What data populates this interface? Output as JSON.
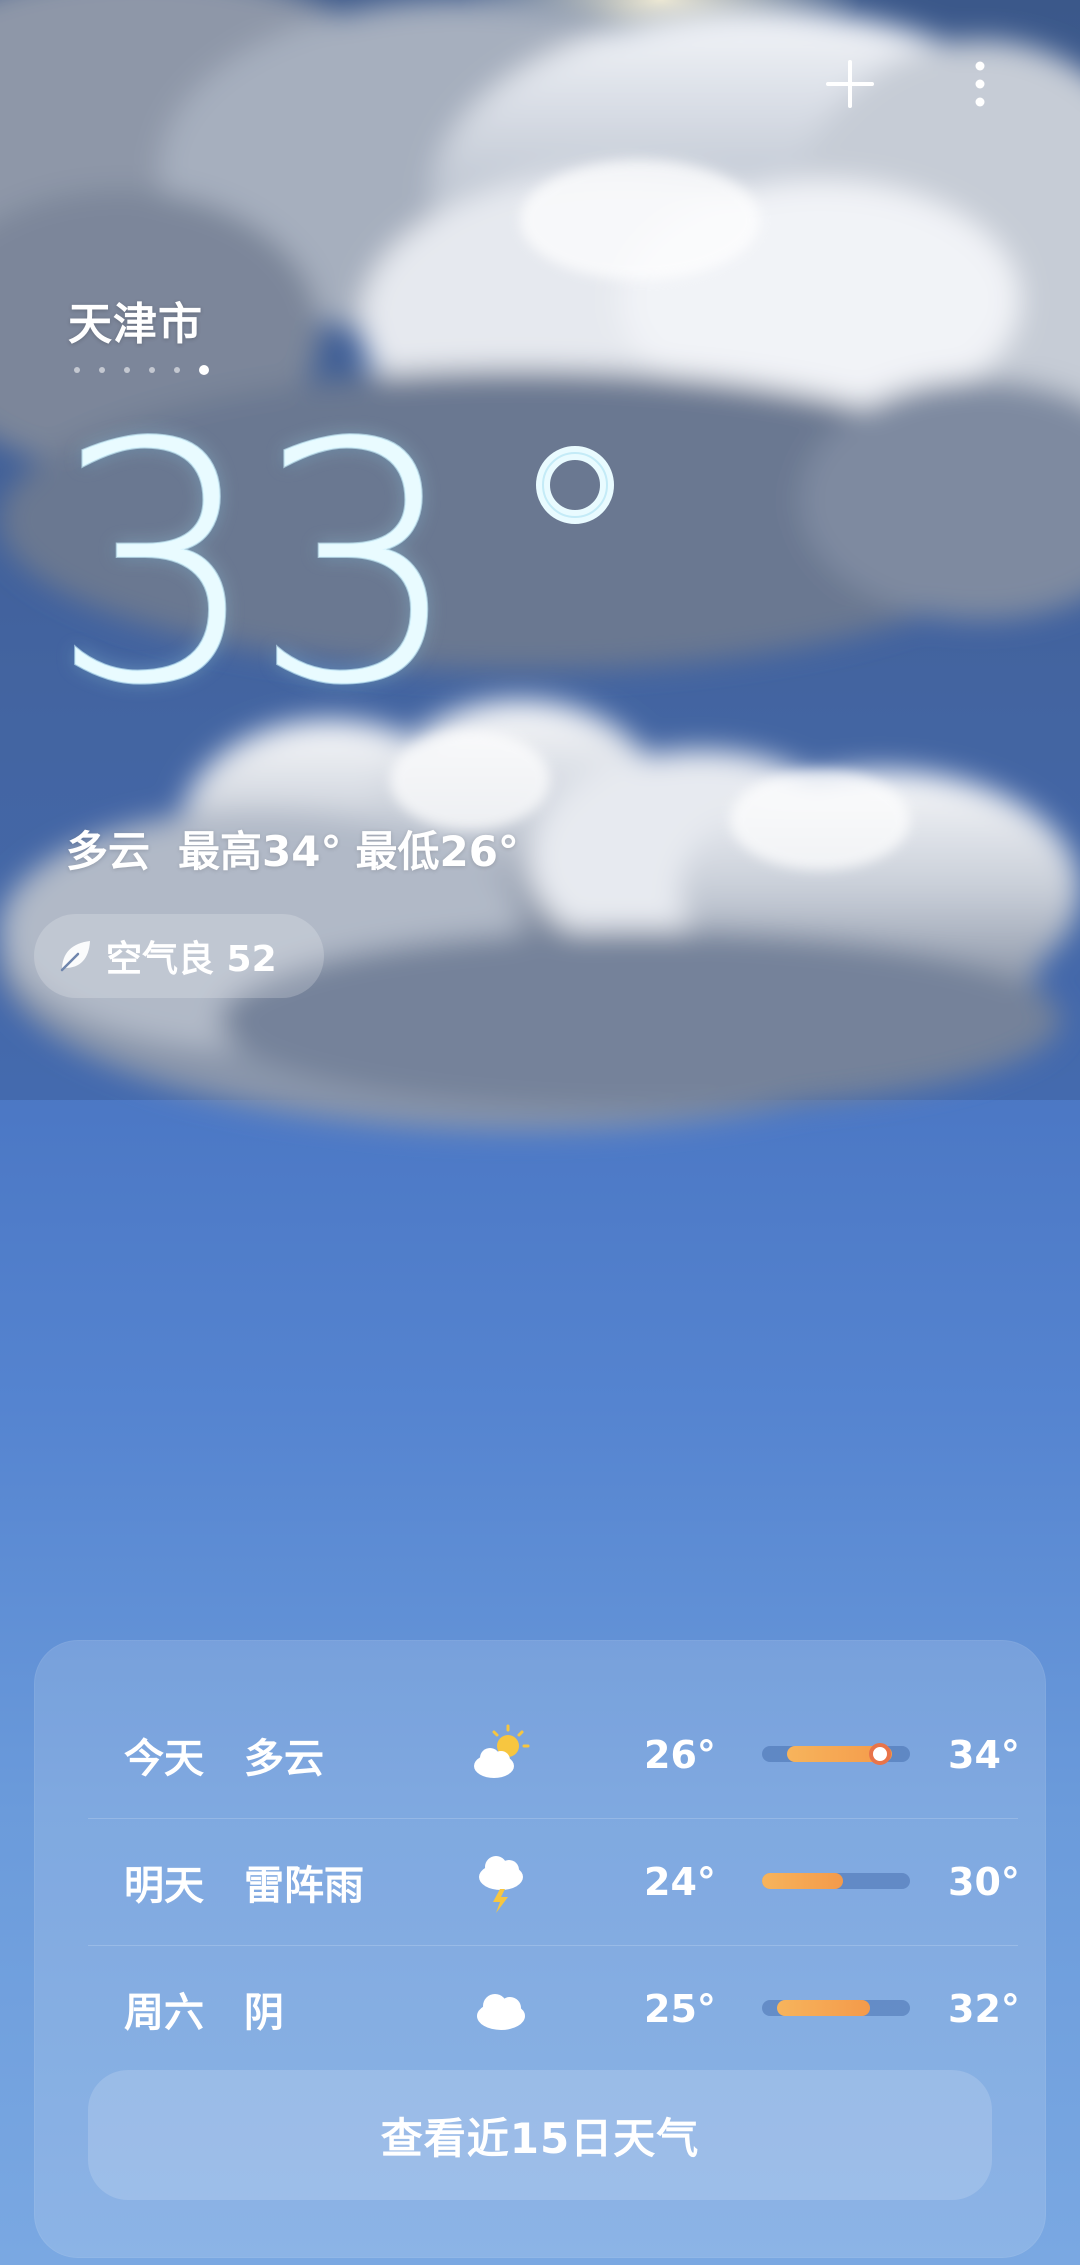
{
  "header": {
    "add_icon": "plus-icon",
    "menu_icon": "more-vertical-icon"
  },
  "location": {
    "city": "天津市",
    "page_count": 6,
    "active_page": 6
  },
  "current": {
    "temperature": "33",
    "condition": "多云",
    "high": "最高34°",
    "low": "最低26°"
  },
  "air_quality": {
    "icon": "leaf-icon",
    "label": "空气良 52"
  },
  "forecast": {
    "days": [
      {
        "day": "今天",
        "condition": "多云",
        "icon": "partly-cloudy-icon",
        "low": "26°",
        "high": "34°",
        "range": [
          0.17,
          0.88
        ],
        "current_marker": 0.8
      },
      {
        "day": "明天",
        "condition": "雷阵雨",
        "icon": "thunderstorm-icon",
        "low": "24°",
        "high": "30°",
        "range": [
          0.0,
          0.55
        ]
      },
      {
        "day": "周六",
        "condition": "阴",
        "icon": "overcast-icon",
        "low": "25°",
        "high": "32°",
        "range": [
          0.1,
          0.73
        ]
      }
    ],
    "more_label": "查看近15日天气"
  },
  "colors": {
    "accent_orange": "#f49a4a",
    "temp_glow": "#e9fbff"
  }
}
